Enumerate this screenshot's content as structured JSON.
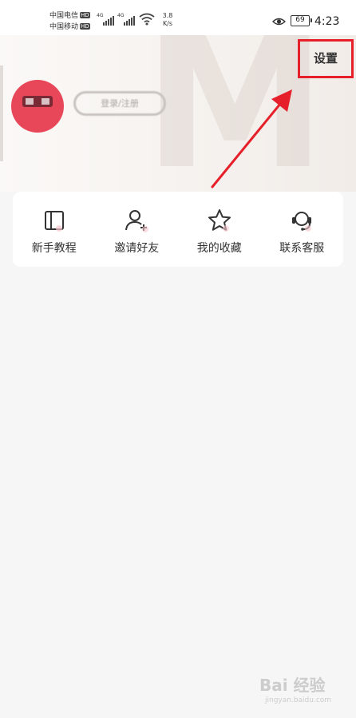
{
  "status_bar": {
    "carrier1": "中国电信",
    "carrier2": "中国移动",
    "hd_badge": "HD",
    "network_tag": "4G",
    "speed_value": "3.8",
    "speed_unit": "K/s",
    "battery": "69",
    "time": "4:23"
  },
  "header": {
    "settings_label": "设置",
    "login_label": "登录/注册",
    "highlight_color": "#e6202b"
  },
  "menu": {
    "items": [
      {
        "label": "新手教程",
        "icon": "book-icon"
      },
      {
        "label": "邀请好友",
        "icon": "add-user-icon"
      },
      {
        "label": "我的收藏",
        "icon": "star-icon"
      },
      {
        "label": "联系客服",
        "icon": "headset-icon"
      }
    ]
  },
  "watermark": {
    "brand": "Bai 经验",
    "url": "jingyan.baidu.com"
  }
}
